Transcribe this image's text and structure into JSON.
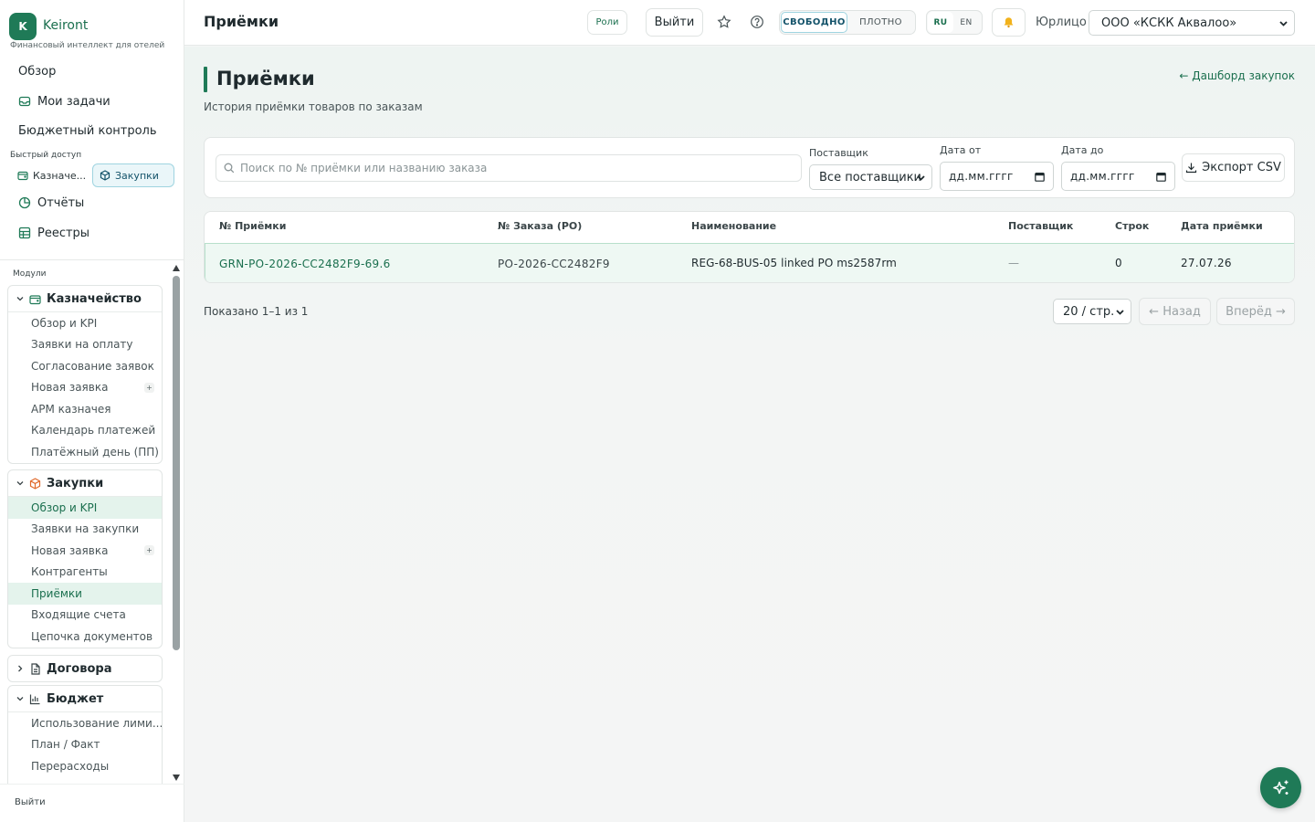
{
  "brand": {
    "logo_letter": "K",
    "name": "Keiront",
    "tagline": "Финансовый интеллект для отелей"
  },
  "sidebar": {
    "top_links": [
      {
        "label": "Обзор"
      },
      {
        "label": "Мои задачи"
      },
      {
        "label": "Бюджетный контроль"
      }
    ],
    "quick_caption": "Быстрый доступ",
    "quick": [
      {
        "label": "Казначе..."
      },
      {
        "label": "Закупки"
      }
    ],
    "mid_links": [
      {
        "label": "Отчёты"
      },
      {
        "label": "Реестры"
      }
    ],
    "modules_caption": "Модули",
    "groups": [
      {
        "title": "Казначейство",
        "items": [
          "Обзор и KPI",
          "Заявки на оплату",
          "Согласование заявок",
          "Новая заявка",
          "АРМ казначея",
          "Календарь платежей",
          "Платёжный день (ПП)"
        ]
      },
      {
        "title": "Закупки",
        "items": [
          "Обзор и KPI",
          "Заявки на закупки",
          "Новая заявка",
          "Контрагенты",
          "Приёмки",
          "Входящие счета",
          "Цепочка документов"
        ]
      },
      {
        "title": "Договора"
      },
      {
        "title": "Бюджет",
        "items": [
          "Использование лими...",
          "План / Факт",
          "Перерасходы"
        ]
      }
    ],
    "plus_label": "+",
    "footer_logout": "Выйти"
  },
  "header": {
    "title": "Приёмки",
    "roles_label": "Роли",
    "logout_label": "Выйти",
    "density": [
      "СВОБОДНО",
      "ПЛОТНО"
    ],
    "languages": [
      "RU",
      "EN"
    ],
    "entity_label": "Юрлицо",
    "entity_value": "ООО «КСКК Аквалоо»"
  },
  "page": {
    "title": "Приёмки",
    "subtitle": "История приёмки товаров по заказам",
    "back_link": "← Дашборд закупок"
  },
  "filters": {
    "search_placeholder": "Поиск по № приёмки или названию заказа",
    "supplier_label": "Поставщик",
    "supplier_value": "Все поставщики",
    "date_from_label": "Дата от",
    "date_from_value": "дд.мм.гггг",
    "date_to_label": "Дата до",
    "date_to_value": "дд.мм.гггг",
    "export_label": "Экспорт CSV"
  },
  "table": {
    "headers": [
      "№ Приёмки",
      "№ Заказа (PO)",
      "Наименование",
      "Поставщик",
      "Строк",
      "Дата приёмки"
    ],
    "rows": [
      [
        "GRN-PO-2026-CC2482F9-69.6",
        "PO-2026-CC2482F9",
        "REG-68-BUS-05 linked PO ms2587rm",
        "—",
        "0",
        "27.07.26"
      ]
    ]
  },
  "pagination": {
    "shown": "Показано 1–1 из 1",
    "per_page": "20 / стр.",
    "prev": "← Назад",
    "next": "Вперёд →"
  },
  "colors": {
    "brand": "#1f7a57",
    "accent_blue": "#9fd4e0",
    "row_highlight": "#eef8f3"
  }
}
